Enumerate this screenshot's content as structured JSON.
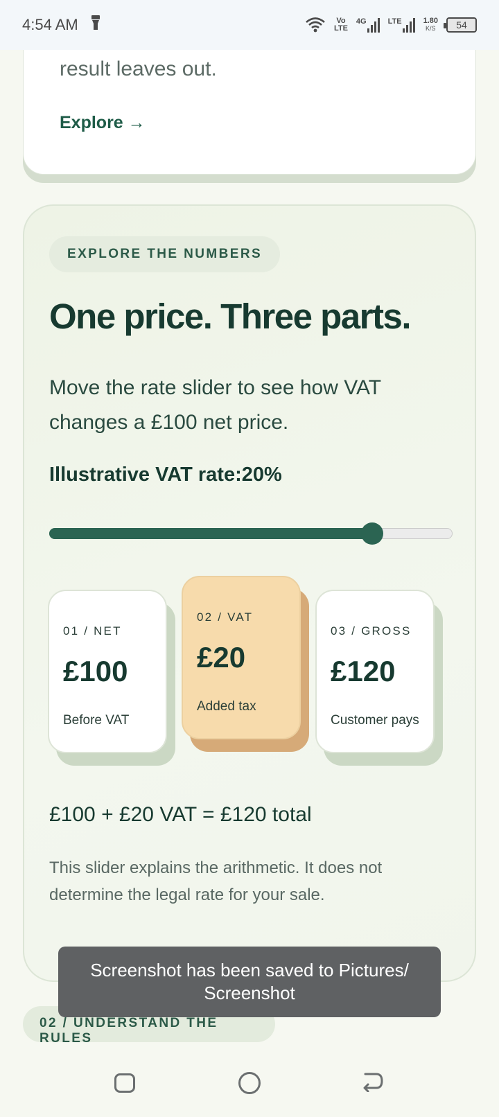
{
  "status_bar": {
    "time": "4:54 AM",
    "volte_top": "Vo",
    "volte_bottom": "LTE",
    "net_4g": "4G",
    "net_lte": "LTE",
    "speed_value": "1.80",
    "speed_unit": "K/S",
    "battery": "54"
  },
  "previous_card": {
    "text": "result leaves out.",
    "link_label": "Explore →"
  },
  "explore": {
    "eyebrow": "EXPLORE THE NUMBERS",
    "heading": "One price. Three parts.",
    "lead": "Move the rate slider to see how VAT changes a £100 net price.",
    "rate_label": "Illustrative VAT rate:",
    "rate_value": "20%",
    "slider": {
      "min": 0,
      "max": 25,
      "value": 20
    },
    "cards": [
      {
        "code": "01 / NET",
        "amount": "£100",
        "caption": "Before VAT"
      },
      {
        "code": "02 / VAT",
        "amount": "£20",
        "caption": "Added tax"
      },
      {
        "code": "03 / GROSS",
        "amount": "£120",
        "caption": "Customer pays"
      }
    ],
    "equation": "£100 + £20 VAT = £120 total",
    "note": "This slider explains the arithmetic. It does not determine the legal rate for your sale."
  },
  "next_section": {
    "label": "02 / UNDERSTAND THE RULES"
  },
  "toast": {
    "message": "Screenshot has been saved to  Pictures/ Screenshot"
  },
  "colors": {
    "accent": "#2b6452",
    "vat_card": "#f7dbac",
    "background": "#f6f8f1"
  }
}
